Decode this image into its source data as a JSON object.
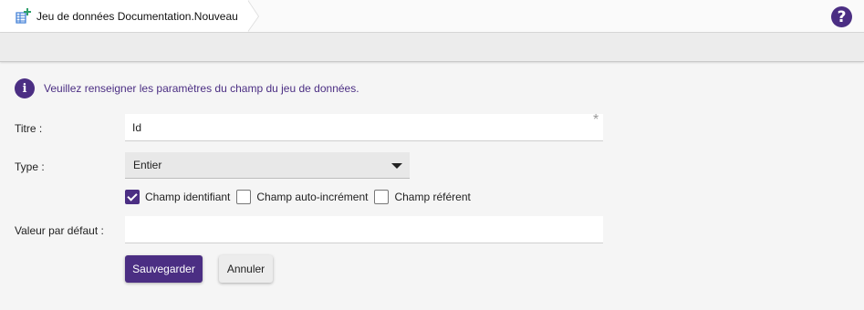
{
  "header": {
    "breadcrumb_icon": "add-table-icon",
    "breadcrumb_label": "Jeu de données Documentation.Nouveau",
    "help_symbol": "?",
    "help_icon": "question-circle-icon"
  },
  "info": {
    "icon": "info-circle-icon",
    "message": "Veuillez renseigner les paramètres du champ du jeu de données."
  },
  "form": {
    "title_label": "Titre :",
    "title_value": "Id",
    "required_mark": "*",
    "type_label": "Type :",
    "type_value": "Entier",
    "checkboxes": [
      {
        "label": "Champ identifiant",
        "checked": true
      },
      {
        "label": "Champ auto-incrément",
        "checked": false
      },
      {
        "label": "Champ référent",
        "checked": false
      }
    ],
    "default_label": "Valeur par défaut :",
    "default_value": "",
    "save_label": "Sauvegarder",
    "cancel_label": "Annuler"
  },
  "colors": {
    "accent": "#4b2e83",
    "icon_green": "#2e9e6b",
    "icon_blue": "#3b7bd4"
  }
}
